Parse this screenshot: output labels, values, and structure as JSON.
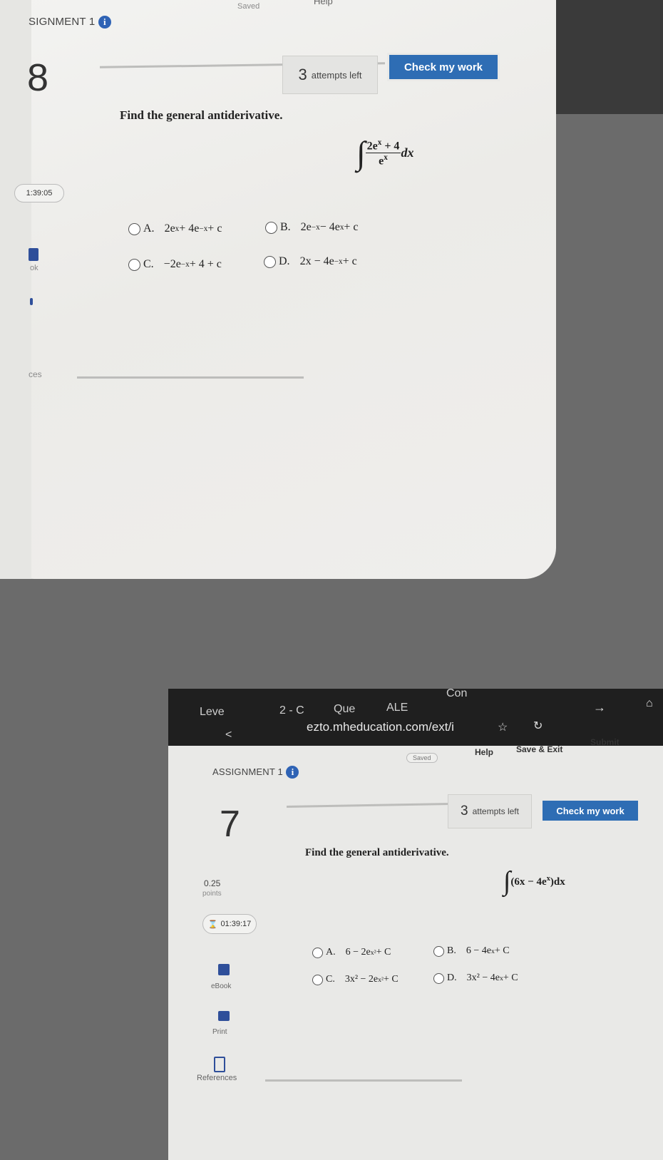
{
  "top": {
    "assignment_title": "SIGNMENT 1",
    "saved": "Saved",
    "help": "Help",
    "question_number": "8",
    "timer": "1:39:05",
    "sidebar": {
      "ebook": "ok",
      "references": "ces"
    },
    "attempts_count": "3",
    "attempts_label": "attempts left",
    "check_button": "Check my work",
    "prompt": "Find the general antiderivative.",
    "integral": {
      "numerator": "2e",
      "num_exp": "x",
      "num_rest": " + 4",
      "denominator": "e",
      "den_exp": "x",
      "dx": "dx"
    },
    "choices": [
      {
        "letter": "A.",
        "parts": [
          "2e",
          "x",
          " + 4e",
          "−x",
          " + c"
        ]
      },
      {
        "letter": "B.",
        "parts": [
          "2e",
          "−x",
          " − 4e",
          "x",
          " + c"
        ]
      },
      {
        "letter": "C.",
        "parts": [
          "−2e",
          "−x",
          " + 4 + c",
          "",
          ""
        ]
      },
      {
        "letter": "D.",
        "parts": [
          "2x − 4e",
          "−x",
          " + c",
          "",
          ""
        ]
      }
    ]
  },
  "bottom": {
    "tabs": [
      "Leve",
      "2 - C",
      "Que",
      "ALE",
      "Con"
    ],
    "url": "ezto.mheducation.com/ext/i",
    "header": {
      "saved": "Saved",
      "help": "Help",
      "save_exit": "Save & Exit",
      "submit": "Submit"
    },
    "assignment_title": "ASSIGNMENT 1",
    "question_number": "7",
    "points_value": "0.25",
    "points_label": "points",
    "timer": "01:39:17",
    "sidebar": {
      "ebook": "eBook",
      "print": "Print",
      "references": "References"
    },
    "attempts_count": "3",
    "attempts_label": "attempts left",
    "check_button": "Check my work",
    "prompt": "Find the general antiderivative.",
    "integral_expr": "(6x − 4e",
    "integral_exp": "x",
    "integral_close": ")dx",
    "choices": [
      {
        "letter": "A.",
        "parts": [
          "6 − 2e",
          "x²",
          " + C"
        ]
      },
      {
        "letter": "B.",
        "parts": [
          "6 − 4e",
          "x",
          " + C"
        ]
      },
      {
        "letter": "C.",
        "parts": [
          "3x² − 2e",
          "x²",
          " + C"
        ]
      },
      {
        "letter": "D.",
        "parts": [
          "3x² − 4e",
          "x",
          " + C"
        ]
      }
    ]
  },
  "colors": {
    "accent": "#2e6db4",
    "background": "#6b6b6b",
    "card": "#efeeec"
  }
}
